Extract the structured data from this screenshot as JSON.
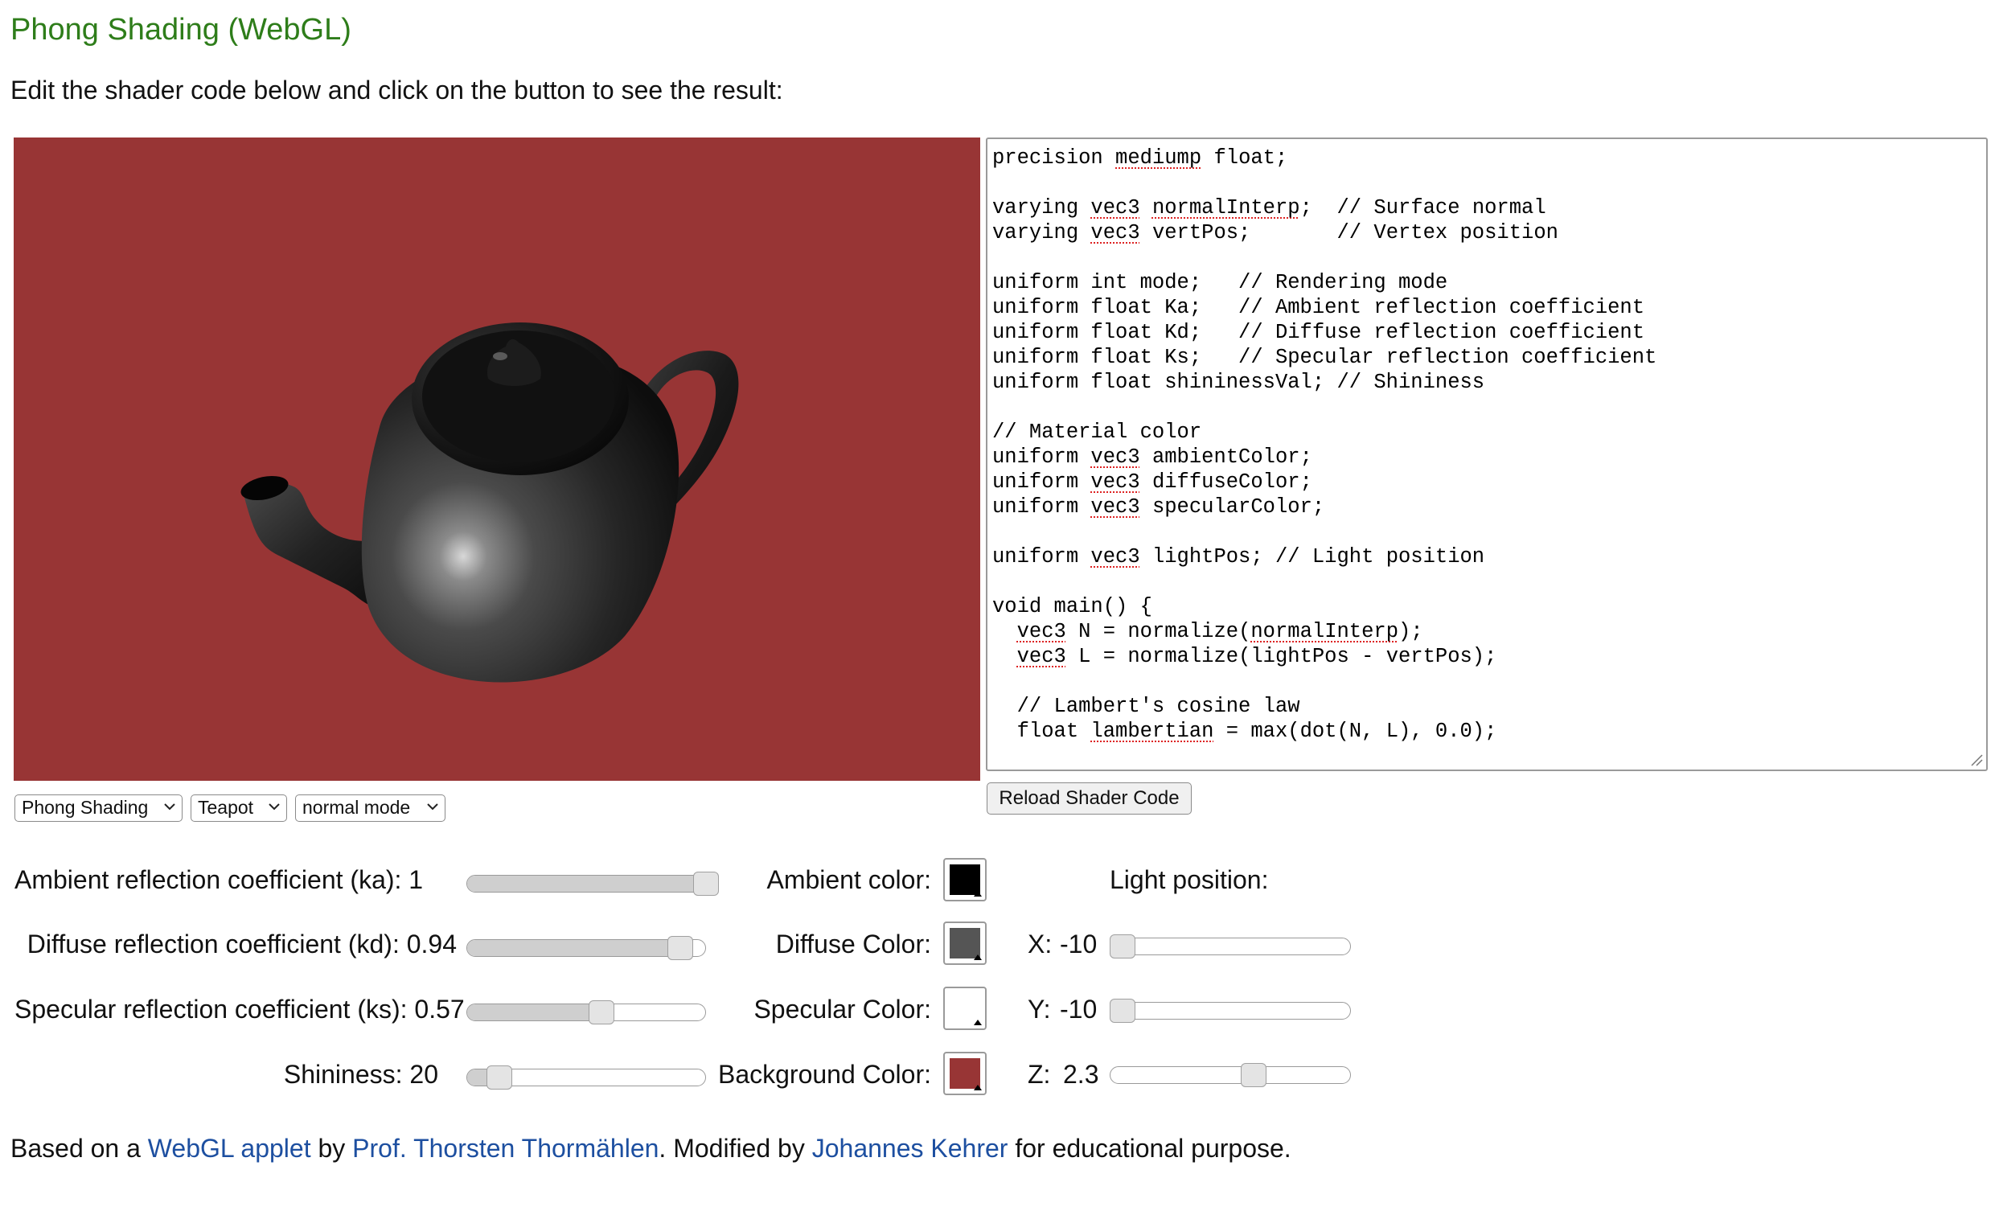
{
  "title": "Phong Shading (WebGL)",
  "intro": "Edit the shader code below and click on the button to see the result:",
  "colors": {
    "title": "#2e7d1a",
    "canvas_background": "#983535",
    "link": "#1d4fa0",
    "teapot": "#1a1a1a"
  },
  "code_lines": [
    [
      {
        "t": "precision "
      },
      {
        "t": "mediump",
        "s": true
      },
      {
        "t": " float;"
      }
    ],
    [],
    [
      {
        "t": "varying "
      },
      {
        "t": "vec3",
        "s": true
      },
      {
        "t": " "
      },
      {
        "t": "normalInterp",
        "s": true
      },
      {
        "t": ";  // Surface normal"
      }
    ],
    [
      {
        "t": "varying "
      },
      {
        "t": "vec3",
        "s": true
      },
      {
        "t": " vertPos;       // Vertex position"
      }
    ],
    [],
    [
      {
        "t": "uniform int mode;   // Rendering mode"
      }
    ],
    [
      {
        "t": "uniform float Ka;   // Ambient reflection coefficient"
      }
    ],
    [
      {
        "t": "uniform float Kd;   // Diffuse reflection coefficient"
      }
    ],
    [
      {
        "t": "uniform float Ks;   // Specular reflection coefficient"
      }
    ],
    [
      {
        "t": "uniform float shininessVal; // Shininess"
      }
    ],
    [],
    [
      {
        "t": "// Material color"
      }
    ],
    [
      {
        "t": "uniform "
      },
      {
        "t": "vec3",
        "s": true
      },
      {
        "t": " ambientColor;"
      }
    ],
    [
      {
        "t": "uniform "
      },
      {
        "t": "vec3",
        "s": true
      },
      {
        "t": " diffuseColor;"
      }
    ],
    [
      {
        "t": "uniform "
      },
      {
        "t": "vec3",
        "s": true
      },
      {
        "t": " specularColor;"
      }
    ],
    [],
    [
      {
        "t": "uniform "
      },
      {
        "t": "vec3",
        "s": true
      },
      {
        "t": " lightPos; // Light position"
      }
    ],
    [],
    [
      {
        "t": "void main() {"
      }
    ],
    [
      {
        "t": "  "
      },
      {
        "t": "vec3",
        "s": true
      },
      {
        "t": " N = normalize("
      },
      {
        "t": "normalInterp",
        "s": true
      },
      {
        "t": ");"
      }
    ],
    [
      {
        "t": "  "
      },
      {
        "t": "vec3",
        "s": true
      },
      {
        "t": " L = normalize(lightPos - vertPos);"
      }
    ],
    [],
    [
      {
        "t": "  // Lambert's cosine law"
      }
    ],
    [
      {
        "t": "  float "
      },
      {
        "t": "lambertian",
        "s": true
      },
      {
        "t": " = max(dot(N, L), 0.0);"
      }
    ]
  ],
  "selects": {
    "shading": "Phong Shading",
    "model": "Teapot",
    "mode": "normal mode"
  },
  "reload_label": "Reload Shader Code",
  "sliders": {
    "ka": {
      "label": "Ambient reflection coefficient (ka): 1",
      "value": 1,
      "min": 0,
      "max": 1
    },
    "kd": {
      "label": "Diffuse reflection coefficient (kd): 0.94",
      "value": 0.94,
      "min": 0,
      "max": 1
    },
    "ks": {
      "label": "Specular reflection coefficient (ks): 0.57",
      "value": 0.57,
      "min": 0,
      "max": 1
    },
    "shininess": {
      "label": "Shininess: 20",
      "value": 20,
      "min": 1,
      "max": 200
    }
  },
  "colors_panel": {
    "ambient": {
      "label": "Ambient color:",
      "value": "#000000"
    },
    "diffuse": {
      "label": "Diffuse Color:",
      "value": "#555555"
    },
    "specular": {
      "label": "Specular Color:",
      "value": "#ffffff"
    },
    "background": {
      "label": "Background Color:",
      "value": "#983535"
    }
  },
  "light": {
    "heading": "Light position:",
    "x": {
      "label": "X:",
      "value": "-10",
      "fraction": 0.0
    },
    "y": {
      "label": "Y:",
      "value": "-10",
      "fraction": 0.0
    },
    "z": {
      "label": "Z:",
      "value": "2.3",
      "fraction": 0.61
    }
  },
  "footer": {
    "t1": "Based on a ",
    "link1": "WebGL applet",
    "t2": " by ",
    "link2": "Prof. Thorsten Thormählen",
    "t3": ". Modified by ",
    "link3": "Johannes Kehrer",
    "t4": " for educational purpose."
  }
}
